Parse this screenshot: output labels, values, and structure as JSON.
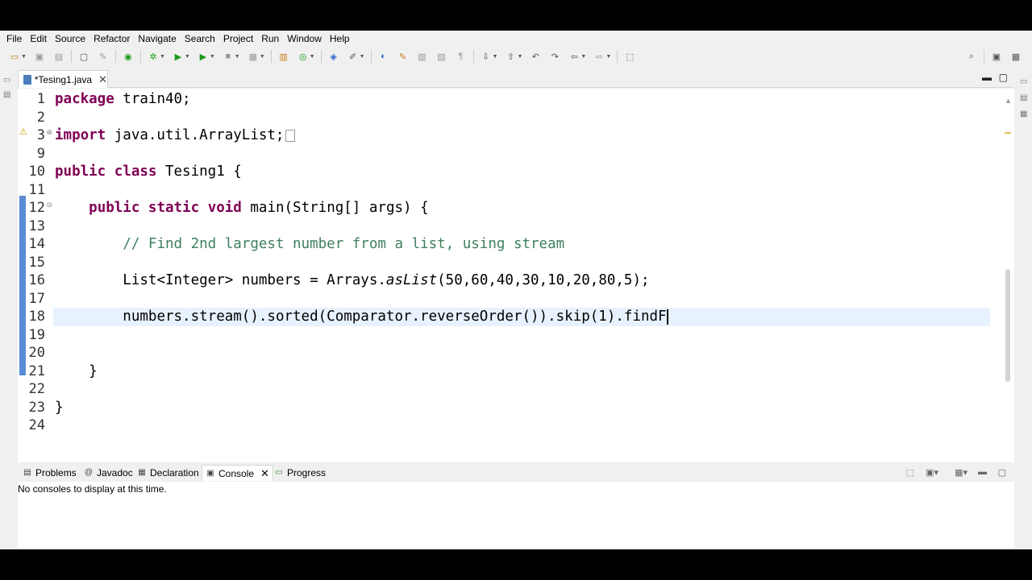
{
  "menu": [
    "File",
    "Edit",
    "Source",
    "Refactor",
    "Navigate",
    "Search",
    "Project",
    "Run",
    "Window",
    "Help"
  ],
  "editor": {
    "tab_label": "*Tesing1.java",
    "lines": [
      {
        "n": "1"
      },
      {
        "n": "2"
      },
      {
        "n": "3"
      },
      {
        "n": "9"
      },
      {
        "n": "10"
      },
      {
        "n": "11"
      },
      {
        "n": "12"
      },
      {
        "n": "13"
      },
      {
        "n": "14"
      },
      {
        "n": "15"
      },
      {
        "n": "16"
      },
      {
        "n": "17"
      },
      {
        "n": "18"
      },
      {
        "n": "19"
      },
      {
        "n": "20"
      },
      {
        "n": "21"
      },
      {
        "n": "22"
      },
      {
        "n": "23"
      },
      {
        "n": "24"
      }
    ],
    "code": {
      "l1_kw": "package",
      "l1_rest": " train40;",
      "l3_kw": "import",
      "l3_rest": " java.util.ArrayList;",
      "l10_kw1": "public",
      "l10_kw2": "class",
      "l10_rest": " Tesing1 {",
      "l12_kw1": "public",
      "l12_kw2": "static",
      "l12_kw3": "void",
      "l12_rest": " main(String[] args) {",
      "l14_comment": "// Find 2nd largest number from a list, using stream",
      "l16_a": "List<Integer> numbers = Arrays.",
      "l16_b": "asList",
      "l16_c": "(50,60,40,30,10,20,80,5);",
      "l18": "numbers.stream().sorted(Comparator.reverseOrder()).skip(1).findF",
      "l21": "}",
      "l23": "}"
    }
  },
  "panel": {
    "tabs": [
      "Problems",
      "Javadoc",
      "Declaration",
      "Console",
      "Progress"
    ],
    "message": "No consoles to display at this time."
  }
}
